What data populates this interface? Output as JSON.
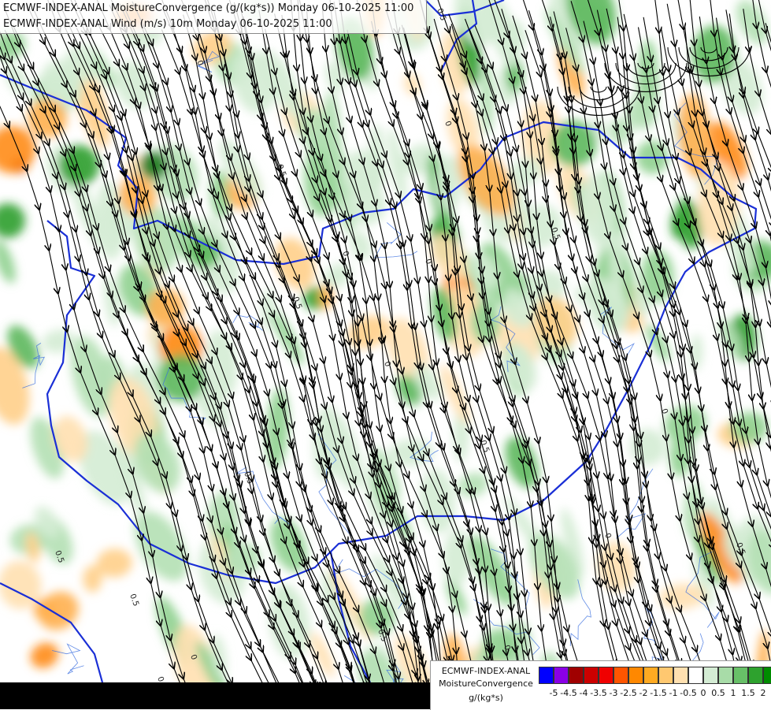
{
  "map": {
    "title_line_1": "ECMWF-INDEX-ANAL MoistureConvergence (g/(kg*s)) Monday 06-10-2025 11:00",
    "title_line_2": "ECMWF-INDEX-ANAL Wind (m/s) 10m Monday 06-10-2025 11:00",
    "background_color": "#ffffff",
    "border_color": "#1a2fd6",
    "river_color": "#3a6ee0",
    "streamline_color": "#000000",
    "contour_labels": [
      "0",
      "0.5",
      "0",
      "0.5",
      "0",
      "0.5",
      "0",
      "0.5",
      "0.5",
      "0",
      "0.5",
      "0",
      "0.5",
      "0.5",
      "0",
      "0.5",
      "0",
      "0.5",
      "0",
      "0.5"
    ]
  },
  "legend": {
    "line_1": "ECMWF-INDEX-ANAL",
    "line_2": "MoistureConvergence",
    "line_3": "g/(kg*s)",
    "colors": [
      "#0000ff",
      "#8a00e6",
      "#a00000",
      "#cc0000",
      "#f00000",
      "#ff5500",
      "#ff8800",
      "#ffaa22",
      "#ffc870",
      "#ffe0b0",
      "#ffffff",
      "#d4ecd4",
      "#a8dca8",
      "#68c068",
      "#2ea22e",
      "#008c00"
    ],
    "ticks": [
      "-5",
      "-4.5",
      "-4",
      "-3.5",
      "-3",
      "-2.5",
      "-2",
      "-1.5",
      "-1",
      "-0.5",
      "0",
      "0.5",
      "1",
      "1.5",
      "2"
    ]
  }
}
